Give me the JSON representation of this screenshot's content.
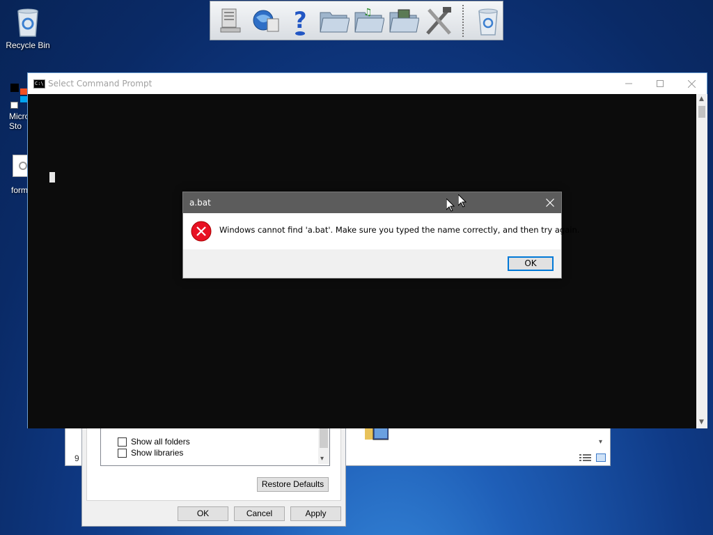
{
  "desktop": {
    "icons": [
      {
        "label": "Recycle Bin"
      },
      {
        "label": "Micro\nSto"
      },
      {
        "label": "form"
      }
    ]
  },
  "toolbar": {
    "buttons": [
      "computer-icon",
      "internet-icon",
      "help-icon",
      "folder-icon",
      "music-folder-icon",
      "pictures-folder-icon",
      "tools-icon",
      "recycle-bin-icon"
    ]
  },
  "folder_options": {
    "checkboxes": [
      {
        "label": "Show all folders",
        "checked": false
      },
      {
        "label": "Show libraries",
        "checked": false
      }
    ],
    "restore_defaults": "Restore Defaults",
    "ok": "OK",
    "cancel": "Cancel",
    "apply": "Apply",
    "left_edge_text": "9"
  },
  "cmd": {
    "title": "Select Command Prompt",
    "icon_text": "C:\\"
  },
  "dialog": {
    "title": "a.bat",
    "message": "Windows cannot find 'a.bat'. Make sure you typed the name correctly, and then try again.",
    "ok": "OK",
    "error_color": "#e81123"
  }
}
